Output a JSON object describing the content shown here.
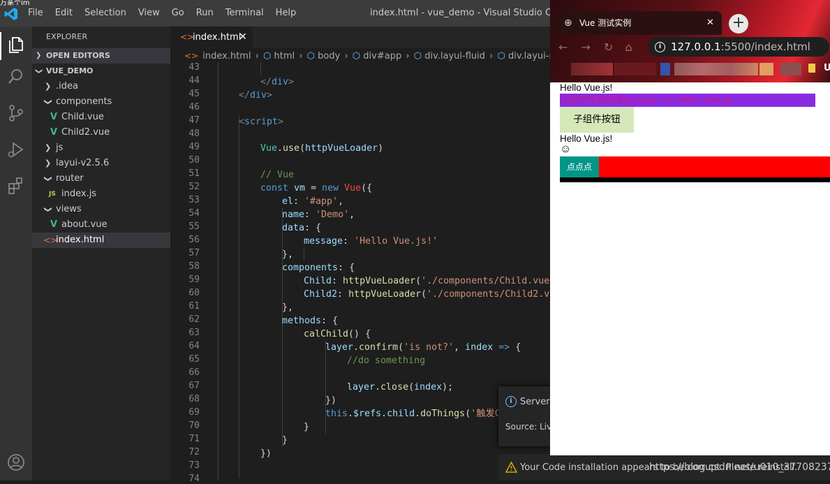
{
  "corner_text": "万篆个im",
  "titlebar": {
    "menu": [
      "File",
      "Edit",
      "Selection",
      "View",
      "Go",
      "Run",
      "Terminal",
      "Help"
    ],
    "title": "index.html - vue_demo - Visual Studio Code [Uns"
  },
  "sidebar": {
    "header": "EXPLORER",
    "open_editors": "OPEN EDITORS",
    "project": "VUE_DEMO",
    "items": [
      {
        "label": ".idea",
        "type": "folder"
      },
      {
        "label": "components",
        "type": "folder-open"
      },
      {
        "label": "Child.vue",
        "type": "vue"
      },
      {
        "label": "Child2.vue",
        "type": "vue"
      },
      {
        "label": "js",
        "type": "folder"
      },
      {
        "label": "layui-v2.5.6",
        "type": "folder"
      },
      {
        "label": "router",
        "type": "folder-open"
      },
      {
        "label": "index.js",
        "type": "js"
      },
      {
        "label": "views",
        "type": "folder-open"
      },
      {
        "label": "about.vue",
        "type": "vue"
      },
      {
        "label": "index.html",
        "type": "html",
        "selected": true
      }
    ]
  },
  "editor": {
    "tab_label": "index.html",
    "breadcrumb": [
      "index.html",
      "html",
      "body",
      "div#app",
      "div.layui-fluid",
      "div.layui-row"
    ],
    "line_numbers": [
      "43",
      "44",
      "45",
      "46",
      "47",
      "48",
      "49",
      "50",
      "51",
      "52",
      "53",
      "54",
      "55",
      "56",
      "57",
      "58",
      "59",
      "60",
      "61",
      "62",
      "63",
      "64",
      "65",
      "66",
      "67",
      "68",
      "69",
      "70",
      "71",
      "72",
      "73",
      "74"
    ]
  },
  "notifications": {
    "server_title": "Server",
    "server_source": "Source: Live",
    "corrupt_message": "Your Code installation appears to be corrupt. Please reinstall."
  },
  "browser": {
    "tab_title": "Vue 测试实例",
    "url_host": "127.0.0.1",
    "url_rest": ":5500/index.html",
    "bookmark_tail": "U",
    "page": {
      "line1": "Hello Vue.js!",
      "props_line": "父组件传递的值(props) => Hello Vue.js!",
      "child_button": "子组件按钮",
      "line2": "Hello Vue.js!",
      "smiley": "☺",
      "click_button": "点点点"
    }
  },
  "watermark": "https://blog.csdn.net/u010_37708237",
  "colors": {
    "accent_blue": "#007acc",
    "vue_green": "#41b883",
    "purple_bar": "#8a2be2",
    "red_bar": "#ff0000",
    "teal_button": "#009688"
  }
}
